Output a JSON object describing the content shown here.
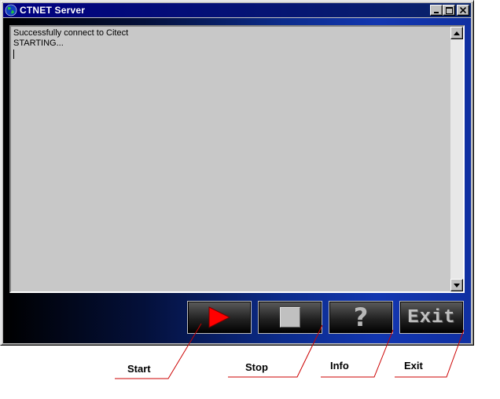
{
  "window": {
    "title": "CTNET Server",
    "icon": "globe-icon",
    "controls": {
      "minimize_icon": "minimize-icon",
      "maximize_icon": "maximize-icon",
      "close_icon": "close-icon"
    }
  },
  "log": {
    "lines": [
      "Successfully connect to Citect",
      "STARTING..."
    ]
  },
  "buttons": {
    "start": {
      "icon": "play-icon",
      "color": "#ff0000"
    },
    "stop": {
      "icon": "stop-icon"
    },
    "info": {
      "glyph": "?"
    },
    "exit": {
      "label": "Exit"
    }
  },
  "callouts": [
    "Start",
    "Stop",
    "Info",
    "Exit"
  ],
  "colors": {
    "titlebar": "#000080",
    "client_dark": "#000000",
    "client_blue": "#1236b0",
    "log_background": "#c8c8c8",
    "callout_line": "#cc0000"
  }
}
